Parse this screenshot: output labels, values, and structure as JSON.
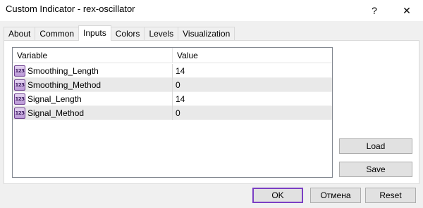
{
  "window": {
    "title": "Custom Indicator - rex-oscillator",
    "help_glyph": "?",
    "close_glyph": "✕"
  },
  "tabs": [
    {
      "label": "About",
      "active": false
    },
    {
      "label": "Common",
      "active": false
    },
    {
      "label": "Inputs",
      "active": true
    },
    {
      "label": "Colors",
      "active": false
    },
    {
      "label": "Levels",
      "active": false
    },
    {
      "label": "Visualization",
      "active": false
    }
  ],
  "inputs_table": {
    "columns": [
      "Variable",
      "Value"
    ],
    "row_icon": "123-icon",
    "row_icon_text": "123",
    "rows": [
      {
        "variable": "Smoothing_Length",
        "value": "14"
      },
      {
        "variable": "Smoothing_Method",
        "value": "0"
      },
      {
        "variable": "Signal_Length",
        "value": "14"
      },
      {
        "variable": "Signal_Method",
        "value": "0"
      }
    ]
  },
  "side_buttons": {
    "load": "Load",
    "save": "Save"
  },
  "footer_buttons": {
    "ok": "OK",
    "cancel": "Отмена",
    "reset": "Reset"
  },
  "colors": {
    "default_button_border": "#7b3fc4",
    "alt_row": "#e9e9e9",
    "icon_accent": "#6a3c8c"
  }
}
